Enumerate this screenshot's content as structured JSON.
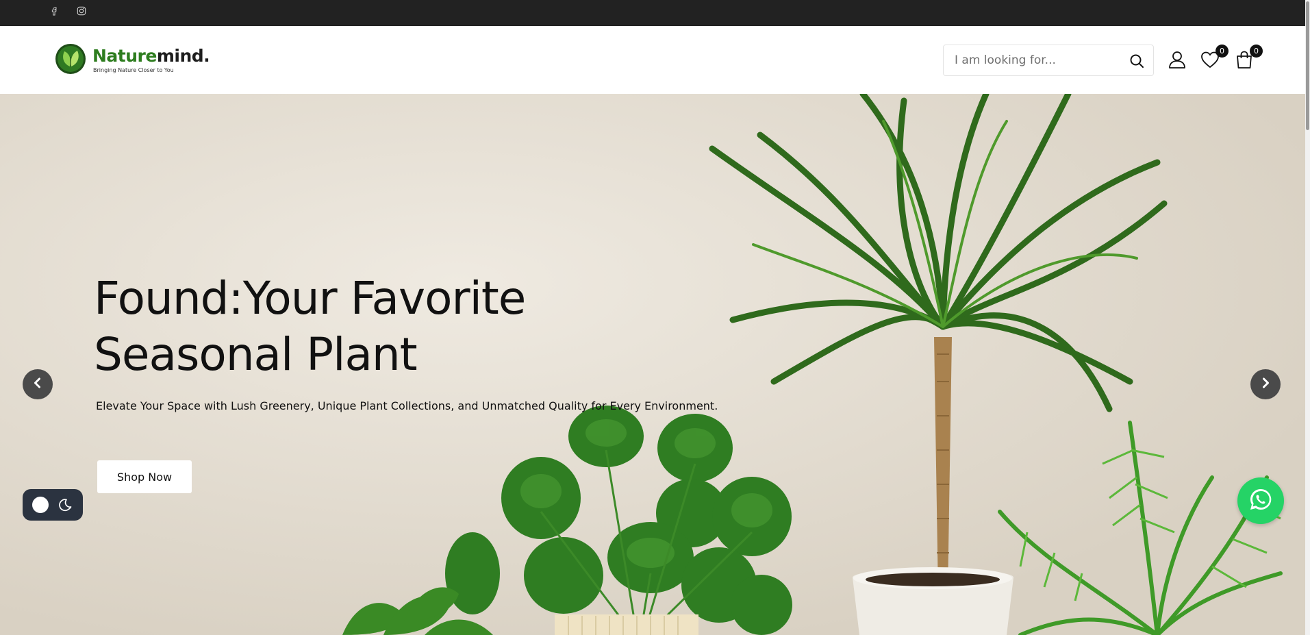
{
  "topbar": {
    "socials": [
      {
        "icon": "facebook-icon"
      },
      {
        "icon": "instagram-icon"
      }
    ]
  },
  "header": {
    "logo": {
      "name_part1": "Nature",
      "name_part2": "mind.",
      "tagline": "Bringing Nature Closer to You"
    },
    "search": {
      "placeholder": "I am looking for...",
      "icon": "search-icon"
    },
    "account_icon": "user-icon",
    "wishlist": {
      "icon": "heart-icon",
      "count": "0"
    },
    "cart": {
      "icon": "shopping-bag-icon",
      "count": "0"
    }
  },
  "hero": {
    "title_line1": "Found:Your Favorite",
    "title_line2": "Seasonal Plant",
    "subtitle": "Elevate Your Space with Lush Greenery, Unique Plant Collections, and Unmatched Quality for Every Environment.",
    "cta_label": "Shop Now",
    "prev_icon": "chevron-left-icon",
    "next_icon": "chevron-right-icon"
  },
  "widgets": {
    "theme_toggle_icon": "moon-icon",
    "whatsapp_icon": "whatsapp-icon"
  },
  "colors": {
    "topbar": "#222222",
    "brand_green": "#2e7d1f",
    "hero_bg": "#e4ddd1",
    "whatsapp": "#25d366",
    "toggle_bg": "#2b3340"
  }
}
